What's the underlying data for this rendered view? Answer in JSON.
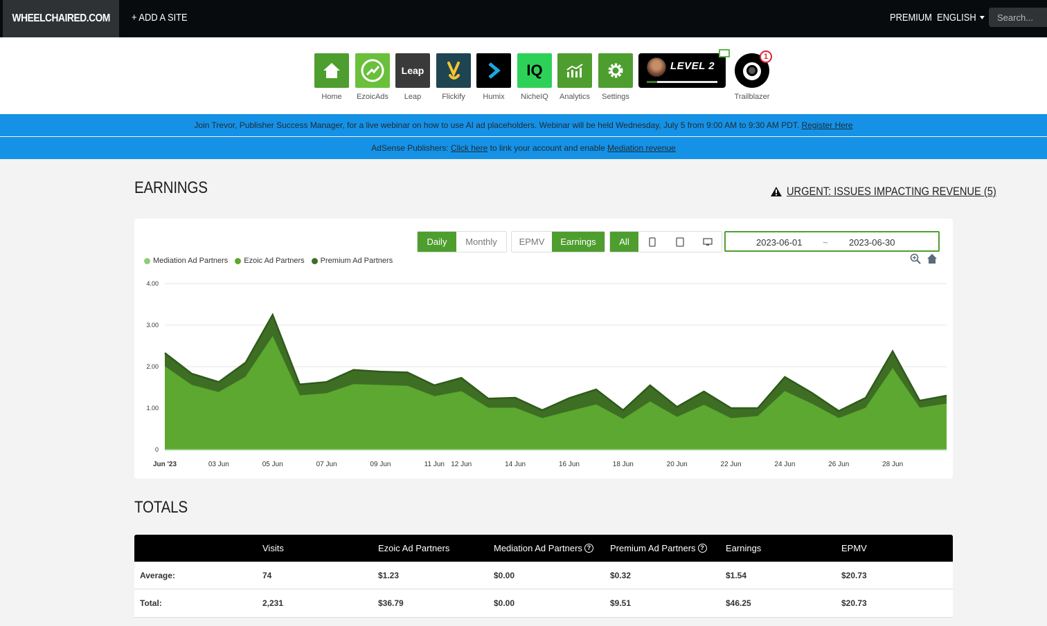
{
  "topbar": {
    "brand": "WHEELCHAIRED.COM",
    "add_site": "+ ADD A SITE",
    "premium": "PREMIUM",
    "language": "ENGLISH",
    "search_placeholder": "Search..."
  },
  "apps": [
    {
      "label": "Home",
      "icon": "home-icon",
      "bg": "#4d9e2e"
    },
    {
      "label": "EzoicAds",
      "icon": "ezoicads-icon",
      "bg": "#6abf3b"
    },
    {
      "label": "Leap",
      "icon": "leap-icon",
      "bg": "#3a3a3a",
      "tile_text": "Leap"
    },
    {
      "label": "Flickify",
      "icon": "flickify-icon",
      "bg": "#1f4552"
    },
    {
      "label": "Humix",
      "icon": "humix-icon",
      "bg": "#000000"
    },
    {
      "label": "NicheIQ",
      "icon": "nicheiq-icon",
      "bg": "#2ed158",
      "tile_text": "IQ"
    },
    {
      "label": "Analytics",
      "icon": "analytics-icon",
      "bg": "#4d9e2e"
    },
    {
      "label": "Settings",
      "icon": "gear-icon",
      "bg": "#4d9e2e"
    }
  ],
  "level": {
    "text": "LEVEL 2",
    "progress": 0.15
  },
  "trailblazer": {
    "label": "Trailblazer",
    "badge": "1"
  },
  "banners": {
    "webinar_text": "Join Trevor, Publisher Success Manager, for a live webinar on how to use AI ad placeholders. Webinar will be held Wednesday, July 5 from 9:00 AM to 9:30 AM PDT.",
    "webinar_link": "Register Here",
    "adsense_prefix": "AdSense Publishers:",
    "adsense_link": "Click here",
    "adsense_mid": "to link your account and enable",
    "adsense_link2": "Mediation revenue"
  },
  "earnings": {
    "title": "EARNINGS",
    "urgent": "URGENT: ISSUES IMPACTING REVENUE (5)",
    "buttons": {
      "daily": "Daily",
      "monthly": "Monthly",
      "epmv": "EPMV",
      "earnings": "Earnings",
      "all": "All"
    },
    "date_start": "2023-06-01",
    "date_sep": "~",
    "date_end": "2023-06-30"
  },
  "colors": {
    "accent": "#4d9e2e",
    "mediation": "#8fcc7a",
    "ezoic": "#5ca830",
    "premium": "#3e6e24",
    "banner": "#1592e6"
  },
  "chart_data": {
    "type": "area",
    "stacked": true,
    "legend": [
      "Mediation Ad Partners",
      "Ezoic Ad Partners",
      "Premium Ad Partners"
    ],
    "ylim": [
      0,
      4
    ],
    "yticks": [
      "4.00",
      "3.00",
      "2.00",
      "1.00",
      "0"
    ],
    "ytick_values": [
      4,
      3,
      2,
      1,
      0
    ],
    "x": [
      "2023-06-01",
      "2023-06-02",
      "2023-06-03",
      "2023-06-04",
      "2023-06-05",
      "2023-06-06",
      "2023-06-07",
      "2023-06-08",
      "2023-06-09",
      "2023-06-10",
      "2023-06-11",
      "2023-06-12",
      "2023-06-13",
      "2023-06-14",
      "2023-06-15",
      "2023-06-16",
      "2023-06-17",
      "2023-06-18",
      "2023-06-19",
      "2023-06-20",
      "2023-06-21",
      "2023-06-22",
      "2023-06-23",
      "2023-06-24",
      "2023-06-25",
      "2023-06-26",
      "2023-06-27",
      "2023-06-28",
      "2023-06-29",
      "2023-06-30"
    ],
    "xticks": [
      {
        "label": "Jun '23",
        "day": 1
      },
      {
        "label": "03 Jun",
        "day": 3
      },
      {
        "label": "05 Jun",
        "day": 5
      },
      {
        "label": "07 Jun",
        "day": 7
      },
      {
        "label": "09 Jun",
        "day": 9
      },
      {
        "label": "11 Jun",
        "day": 11
      },
      {
        "label": "12 Jun",
        "day": 12
      },
      {
        "label": "14 Jun",
        "day": 14
      },
      {
        "label": "16 Jun",
        "day": 16
      },
      {
        "label": "18 Jun",
        "day": 18
      },
      {
        "label": "20 Jun",
        "day": 20
      },
      {
        "label": "22 Jun",
        "day": 22
      },
      {
        "label": "24 Jun",
        "day": 24
      },
      {
        "label": "26 Jun",
        "day": 26
      },
      {
        "label": "28 Jun",
        "day": 28
      }
    ],
    "series": [
      {
        "name": "Mediation Ad Partners",
        "values": [
          0,
          0,
          0,
          0,
          0,
          0,
          0,
          0,
          0,
          0,
          0,
          0,
          0,
          0,
          0,
          0,
          0,
          0,
          0,
          0,
          0,
          0,
          0,
          0,
          0,
          0,
          0,
          0,
          0,
          0
        ]
      },
      {
        "name": "Ezoic Ad Partners",
        "values": [
          2.0,
          1.55,
          1.38,
          1.75,
          2.72,
          1.3,
          1.35,
          1.57,
          1.55,
          1.53,
          1.28,
          1.4,
          1.0,
          1.0,
          0.75,
          0.92,
          1.08,
          0.73,
          1.15,
          0.78,
          1.07,
          0.75,
          0.8,
          1.4,
          1.1,
          0.75,
          1.0,
          1.95,
          1.0,
          1.1
        ]
      },
      {
        "name": "Premium Ad Partners",
        "values": [
          0.33,
          0.28,
          0.25,
          0.35,
          0.53,
          0.27,
          0.28,
          0.35,
          0.33,
          0.33,
          0.27,
          0.33,
          0.23,
          0.25,
          0.2,
          0.32,
          0.37,
          0.22,
          0.4,
          0.25,
          0.33,
          0.25,
          0.2,
          0.35,
          0.27,
          0.18,
          0.25,
          0.42,
          0.18,
          0.2
        ]
      }
    ]
  },
  "totals": {
    "title": "TOTALS",
    "columns": [
      "",
      "Visits",
      "Ezoic Ad Partners",
      "Mediation Ad Partners",
      "Premium Ad Partners",
      "Earnings",
      "EPMV"
    ],
    "rows": [
      [
        "Average:",
        "74",
        "$1.23",
        "$0.00",
        "$0.32",
        "$1.54",
        "$20.73"
      ],
      [
        "Total:",
        "2,231",
        "$36.79",
        "$0.00",
        "$9.51",
        "$46.25",
        "$20.73"
      ]
    ]
  }
}
